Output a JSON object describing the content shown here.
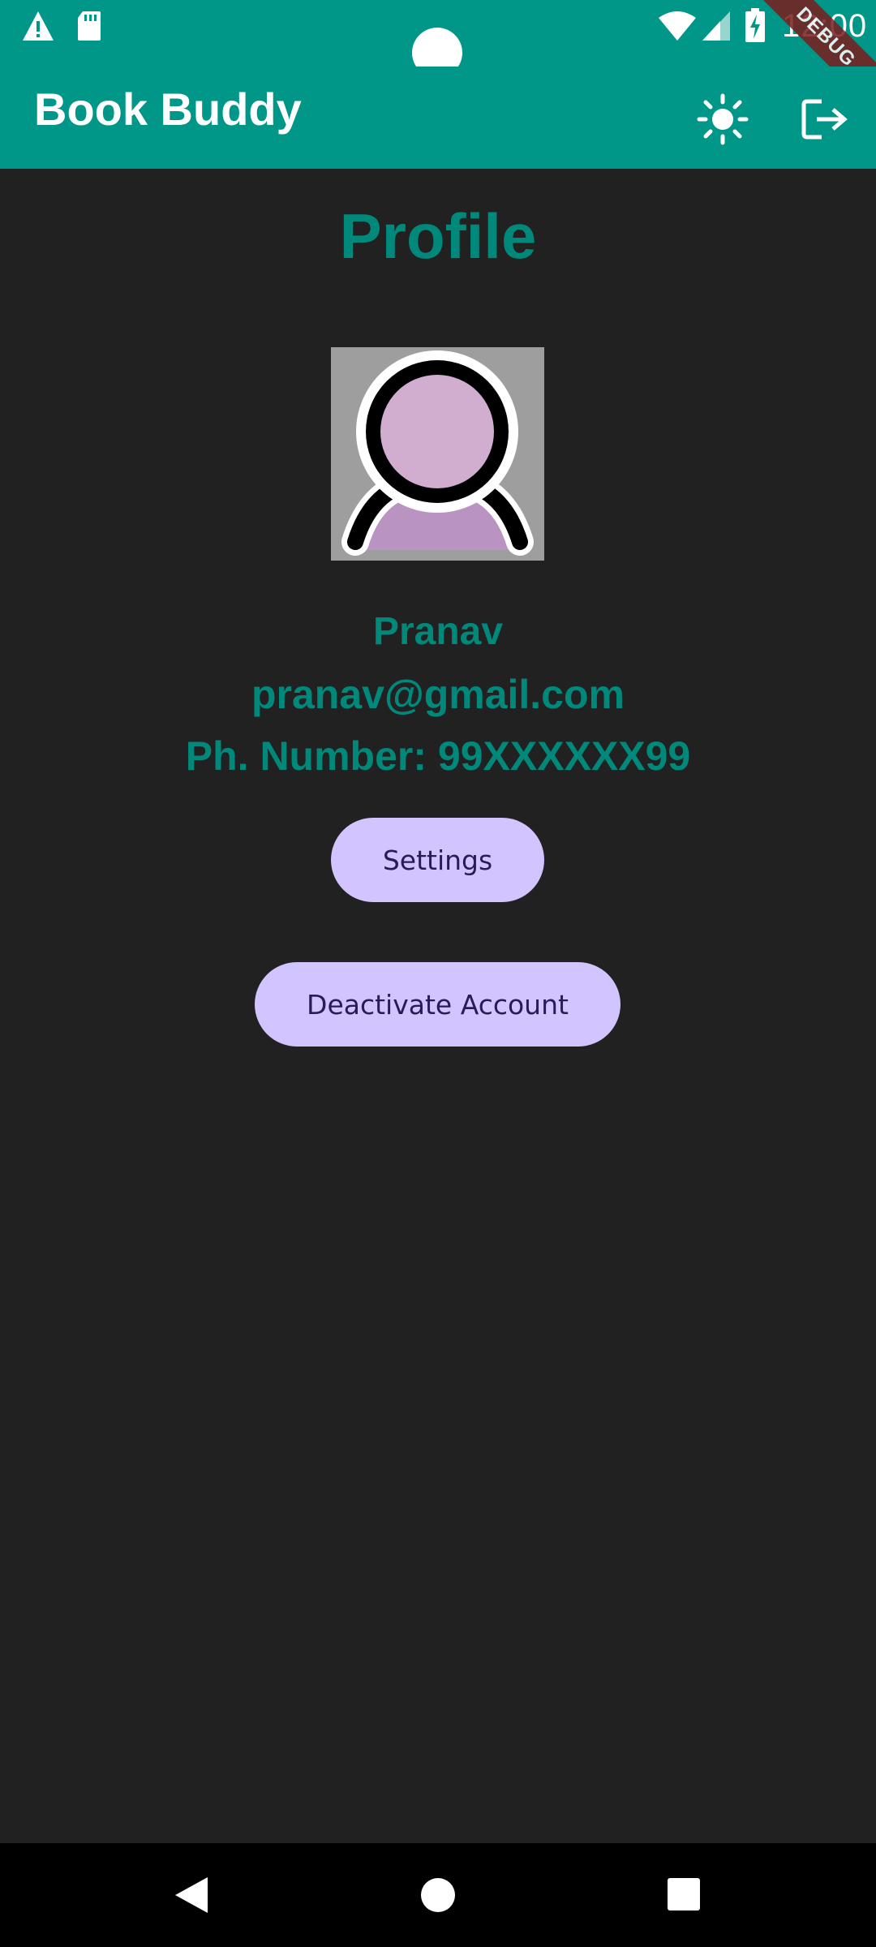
{
  "status_bar": {
    "time": "12:00",
    "icons": [
      "warning-icon",
      "sd-card-icon",
      "wifi-icon",
      "cell-signal-icon",
      "battery-charging-icon"
    ],
    "debug_label": "DEBUG"
  },
  "app_bar": {
    "title": "Book Buddy",
    "actions": [
      "brightness-icon",
      "logout-icon"
    ]
  },
  "profile": {
    "heading": "Profile",
    "avatar_icon": "user-avatar-icon",
    "name": "Pranav",
    "email": "pranav@gmail.com",
    "phone": "Ph. Number: 99XXXXXX99"
  },
  "buttons": {
    "settings": "Settings",
    "deactivate": "Deactivate Account"
  },
  "colors": {
    "primary": "#009688",
    "accent_text": "#00897b",
    "background": "#212121",
    "button_bg": "#d1c4ff",
    "button_text": "#2b1a5a"
  },
  "nav_bar": {
    "icons": [
      "back-icon",
      "home-icon",
      "recents-icon"
    ]
  }
}
